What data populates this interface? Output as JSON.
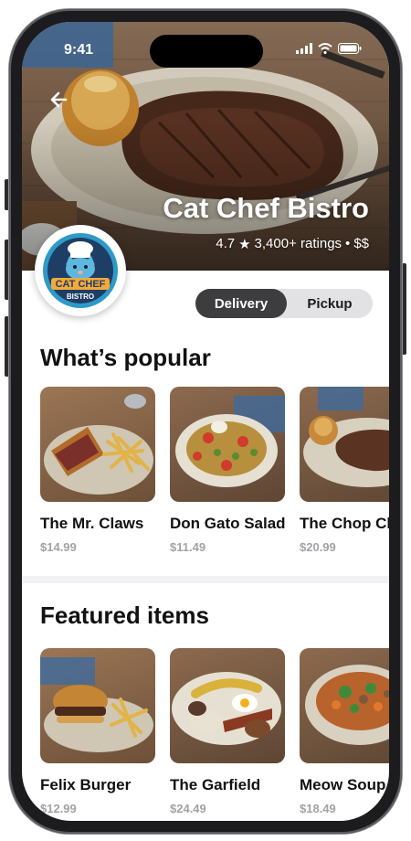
{
  "status_bar": {
    "time": "9:41"
  },
  "restaurant": {
    "name": "Cat Chef Bistro",
    "rating": "4.7",
    "rating_icon": "star-icon",
    "ratings_count": "3,400+ ratings",
    "separator": "•",
    "price_level": "$$",
    "logo": {
      "line1": "CAT CHEF",
      "line2": "BISTRO"
    }
  },
  "order_mode": {
    "delivery_label": "Delivery",
    "pickup_label": "Pickup",
    "selected": "Delivery"
  },
  "popular": {
    "title": "What’s popular",
    "items": [
      {
        "name": "The Mr. Claws",
        "price": "$14.99"
      },
      {
        "name": "Don Gato Salad",
        "price": "$11.49"
      },
      {
        "name": "The Chop Ch",
        "price": "$20.99"
      }
    ]
  },
  "featured": {
    "title": "Featured items",
    "items": [
      {
        "name": "Felix Burger",
        "price": "$12.99"
      },
      {
        "name": "The Garfield",
        "price": "$24.49"
      },
      {
        "name": "Meow Soup",
        "price": "$18.49"
      }
    ]
  },
  "colors": {
    "toggle_active": "#3d3d40",
    "toggle_track": "#e2e2e4",
    "price_gray": "#a2a2a6",
    "logo_navy": "#1f3e66",
    "logo_teal": "#2f9ac7"
  }
}
